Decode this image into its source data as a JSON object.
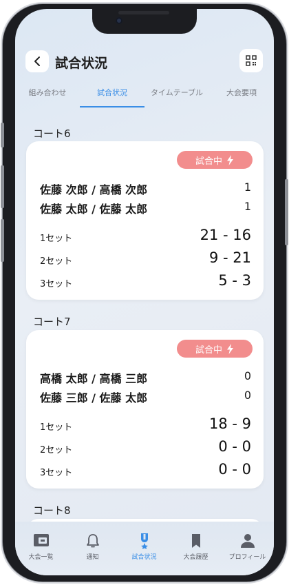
{
  "header": {
    "title": "試合状況"
  },
  "tabs": [
    {
      "label": "組み合わせ"
    },
    {
      "label": "試合状況"
    },
    {
      "label": "タイムテーブル"
    },
    {
      "label": "大会要項"
    }
  ],
  "courts": [
    {
      "label": "コート6",
      "status": "試合中",
      "teams": [
        {
          "names": "佐藤 次郎 / 高橋 次郎",
          "points": "1"
        },
        {
          "names": "佐藤 太郎 / 佐藤 太郎",
          "points": "1"
        }
      ],
      "sets": [
        {
          "label": "1セット",
          "score": "21 - 16"
        },
        {
          "label": "2セット",
          "score": "9 - 21"
        },
        {
          "label": "3セット",
          "score": "5 - 3"
        }
      ]
    },
    {
      "label": "コート7",
      "status": "試合中",
      "teams": [
        {
          "names": "高橋 太郎 / 高橋 三郎",
          "points": "0"
        },
        {
          "names": "佐藤 三郎 / 佐藤 太郎",
          "points": "0"
        }
      ],
      "sets": [
        {
          "label": "1セット",
          "score": "18 - 9"
        },
        {
          "label": "2セット",
          "score": "0 - 0"
        },
        {
          "label": "3セット",
          "score": "0 - 0"
        }
      ]
    },
    {
      "label": "コート8"
    }
  ],
  "bottom_nav": [
    {
      "label": "大会一覧",
      "icon": "tournament-list-icon"
    },
    {
      "label": "通知",
      "icon": "bell-icon"
    },
    {
      "label": "試合状況",
      "icon": "trophy-icon"
    },
    {
      "label": "大会履歴",
      "icon": "bookmark-icon"
    },
    {
      "label": "プロフィール",
      "icon": "person-icon"
    }
  ],
  "colors": {
    "accent": "#3a8ee6",
    "badge": "#f28d8d",
    "badge_orange": "#f5a46a"
  }
}
